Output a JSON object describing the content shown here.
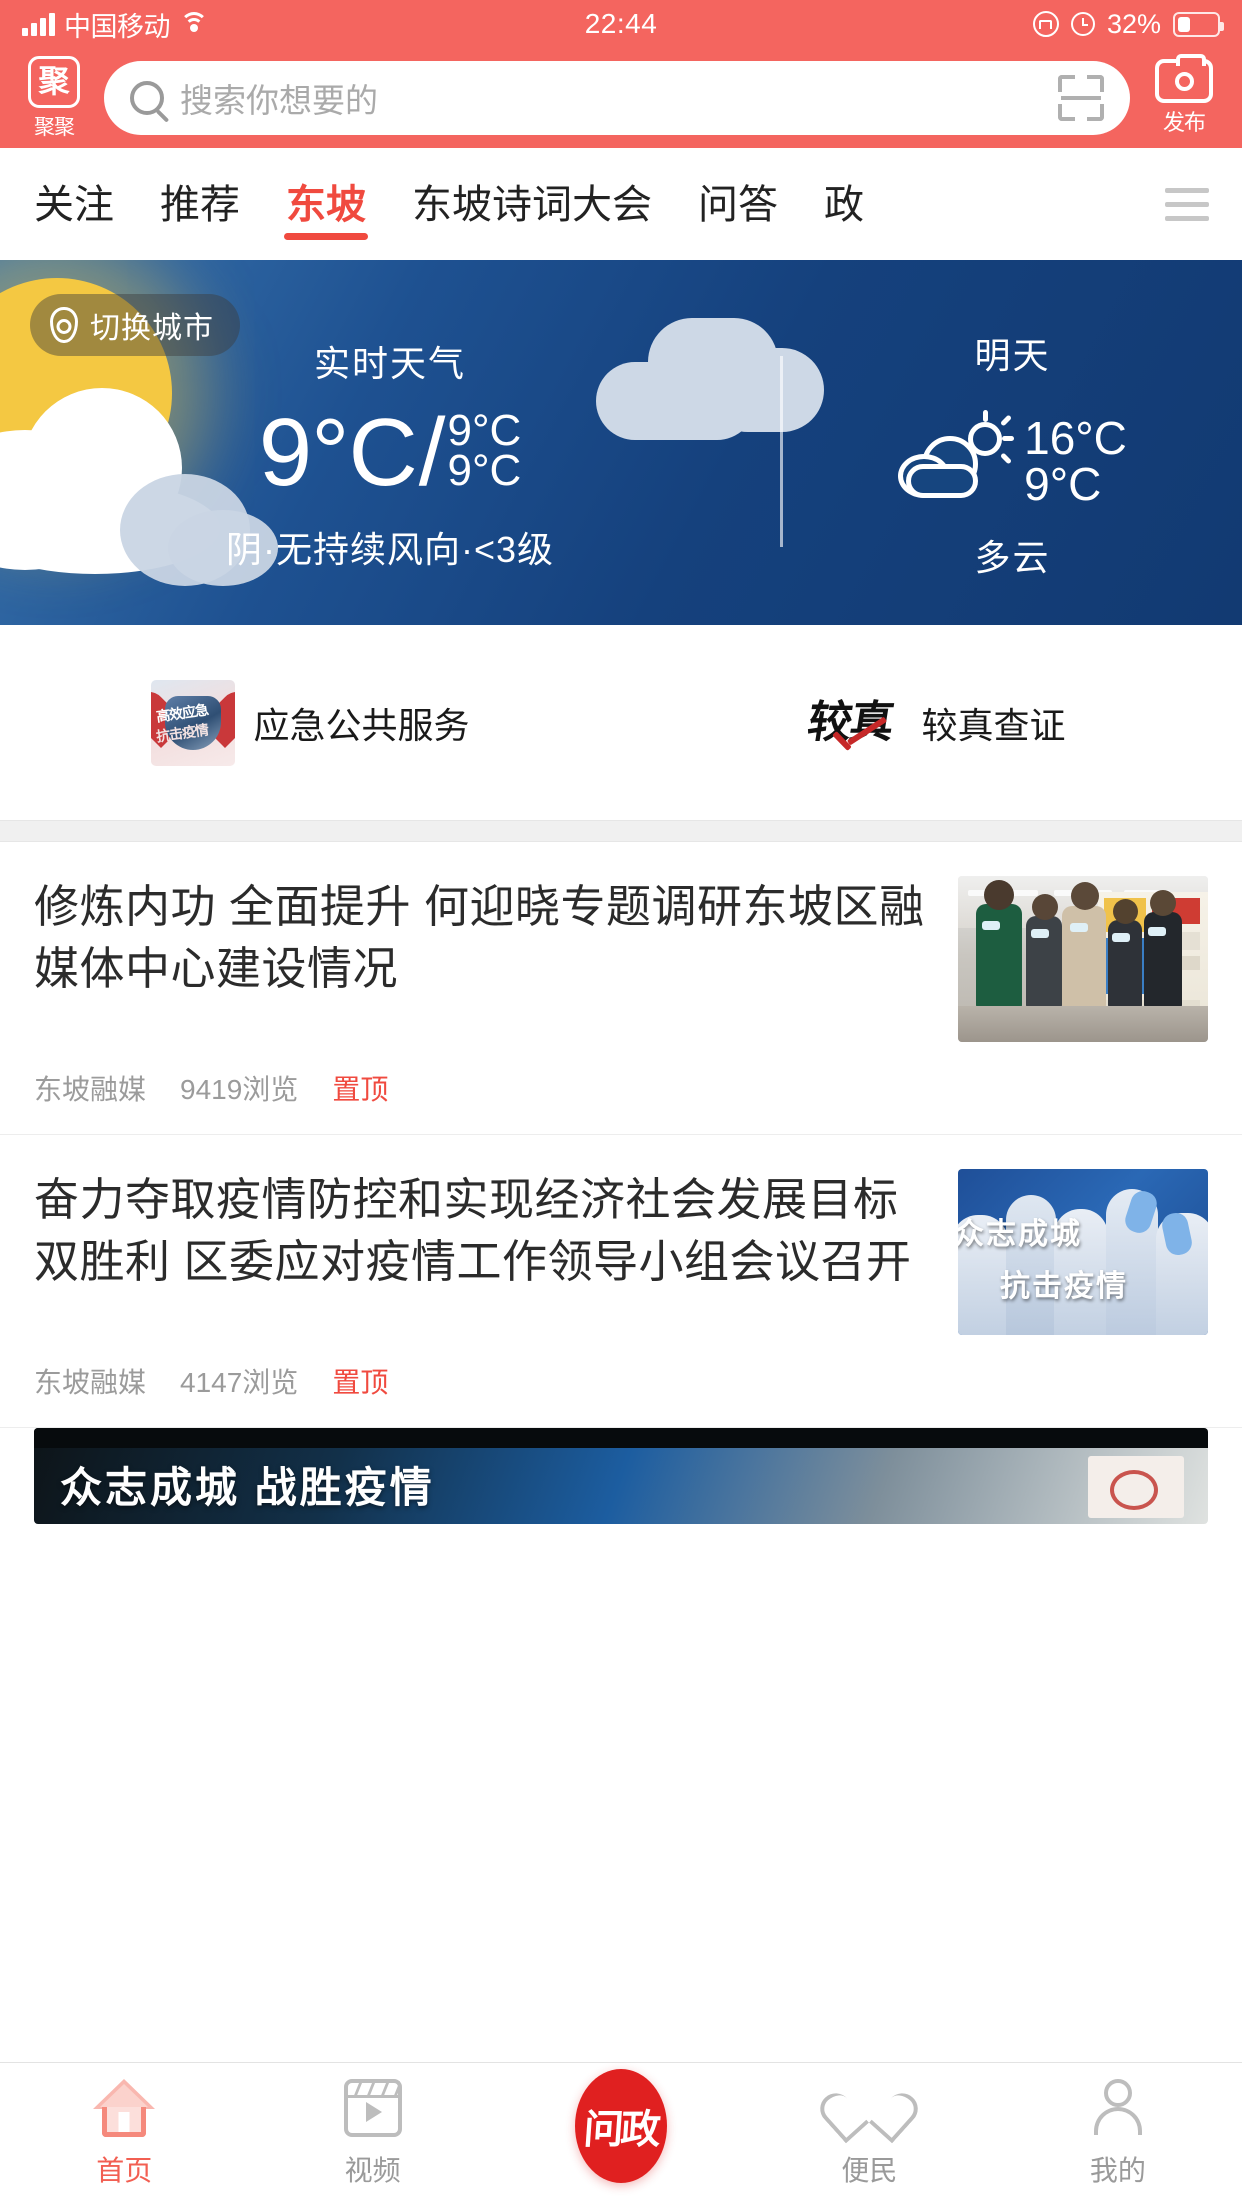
{
  "status_bar": {
    "carrier": "中国移动",
    "time": "22:44",
    "battery_percent": "32%",
    "icons": [
      "signal-icon",
      "wifi-icon",
      "rotation-lock-icon",
      "alarm-icon",
      "battery-icon"
    ]
  },
  "header": {
    "app_logo_glyph": "聚",
    "app_logo_label": "聚聚",
    "search_placeholder": "搜索你想要的",
    "publish_label": "发布"
  },
  "channel_tabs": {
    "items": [
      {
        "label": "关注",
        "active": false
      },
      {
        "label": "推荐",
        "active": false
      },
      {
        "label": "东坡",
        "active": true
      },
      {
        "label": "东坡诗词大会",
        "active": false
      },
      {
        "label": "问答",
        "active": false
      },
      {
        "label": "政",
        "active": false
      }
    ],
    "active_color": "#F04A3F"
  },
  "weather": {
    "city_switch_label": "切换城市",
    "now": {
      "label": "实时天气",
      "temp_main": "9°C",
      "separator": "/",
      "temp_high": "9°C",
      "temp_low": "9°C",
      "description": "阴·无持续风向·<3级"
    },
    "tomorrow": {
      "label": "明天",
      "temp_high": "16°C",
      "temp_low": "9°C",
      "condition": "多云",
      "icon": "partly-cloudy-icon"
    }
  },
  "services": [
    {
      "label": "应急公共服务",
      "icon": "emergency-heart-icon",
      "icon_text_1": "高效应急",
      "icon_text_2": "抗击疫情"
    },
    {
      "label": "较真查证",
      "icon": "jiaozhen-logo-icon",
      "icon_glyph": "较真"
    }
  ],
  "feed": {
    "items": [
      {
        "title": "修炼内功 全面提升 何迎晓专题调研东坡区融媒体中心建设情况",
        "source": "东坡融媒",
        "views": "9419浏览",
        "badge": "置顶",
        "thumb": "office-corridor-photo"
      },
      {
        "title": "奋力夺取疫情防控和实现经济社会发展目标双胜利 区委应对疫情工作领导小组会议召开",
        "source": "东坡融媒",
        "views": "4147浏览",
        "badge": "置顶",
        "thumb": "medical-staff-banner",
        "thumb_text_1": "众志成城",
        "thumb_text_2": "抗击疫情"
      }
    ],
    "partial_banner_text": "众志成城 战胜疫情"
  },
  "tabbar": {
    "items": [
      {
        "label": "首页",
        "icon": "home-icon",
        "active": true
      },
      {
        "label": "视频",
        "icon": "video-icon",
        "active": false
      },
      {
        "label": "",
        "icon": "wenzheng-icon",
        "glyph": "问政",
        "active": false
      },
      {
        "label": "便民",
        "icon": "heart-icon",
        "active": false
      },
      {
        "label": "我的",
        "icon": "user-icon",
        "active": false
      }
    ],
    "active_color": "#F25F52"
  },
  "colors": {
    "brand_red": "#F4655F",
    "accent_red": "#F04A3F",
    "weather_blue": "#15417d"
  }
}
